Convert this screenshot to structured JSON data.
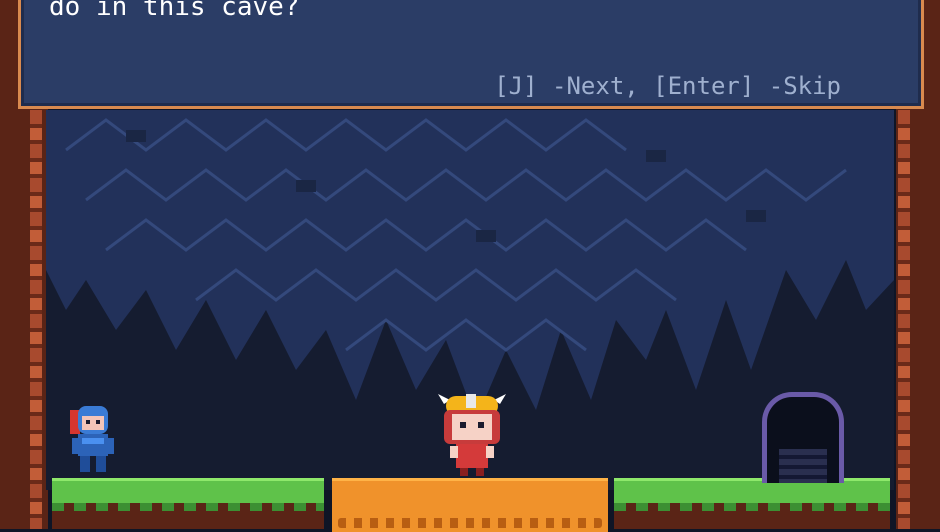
{
  "dialog": {
    "text": "do in this cave?",
    "hint": "[J] -Next, [Enter] -Skip"
  },
  "characters": [
    {
      "name": "knight"
    },
    {
      "name": "girl"
    }
  ],
  "colors": {
    "cave": "#151c30",
    "rock": "#2b3d66",
    "grass": "#5fc24a",
    "bridge": "#f0922b",
    "wall": "#5a2416",
    "dialog_border": "#d98a4f"
  }
}
